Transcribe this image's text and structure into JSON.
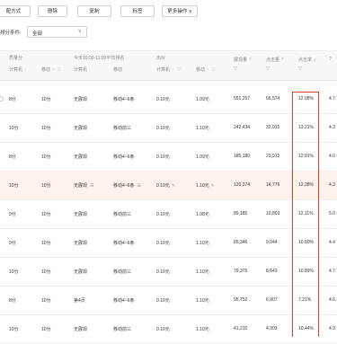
{
  "toolbar": {
    "buttons": [
      "配方式",
      "删除",
      "复制",
      "标签",
      "更多操作"
    ],
    "more_chevron": "∨"
  },
  "filter": {
    "label": "排分条件:",
    "value": "全部",
    "chevron": "∨"
  },
  "headers": {
    "group_quality": "质量分",
    "group_rank": "今天10:00-11:00平均排名",
    "group_bid": "出价",
    "pc": "计算机",
    "mobile": "移动",
    "impressions": "展现量",
    "clicks": "点击量",
    "ctr": "点击率",
    "sort": "↑",
    "sort_active": "↓",
    "filter_glyph": "▽",
    "info": "?"
  },
  "rows": [
    {
      "q_pc": "8分",
      "q_mob": "10分",
      "r_pc": "无展现",
      "r_mob": "移动4~6条",
      "bid_pc": "0.10元",
      "bid_mob": "1.09元",
      "imp": "551,257",
      "clk": "66,574",
      "ctr": "12.08%",
      "extra": "4.7"
    },
    {
      "q_pc": "10分",
      "q_mob": "10分",
      "r_pc": "无展现",
      "r_mob": "移动前三",
      "bid_pc": "0.10元",
      "bid_mob": "1.10元",
      "imp": "242,434",
      "clk": "32,015",
      "ctr": "13.21%",
      "extra": "4.3"
    },
    {
      "q_pc": "8分",
      "q_mob": "10分",
      "r_pc": "无展现",
      "r_mob": "移动4~6条",
      "bid_pc": "0.10元",
      "bid_mob": "1.09元",
      "imp": "185,180",
      "clk": "23,915",
      "ctr": "12.91%",
      "extra": "4.0"
    },
    {
      "q_pc": "10分",
      "q_mob": "10分",
      "r_pc": "无展现",
      "r_mob": "移动4~6条",
      "bid_pc": "0.10元",
      "bid_mob": "1.10元",
      "imp": "120,374",
      "clk": "14,776",
      "ctr": "12.28%",
      "extra": "4.3"
    },
    {
      "q_pc": "9分",
      "q_mob": "10分",
      "r_pc": "无展现",
      "r_mob": "移动前三",
      "bid_pc": "0.10元",
      "bid_mob": "1.08元",
      "imp": "89,185",
      "clk": "10,803",
      "ctr": "12.11%",
      "extra": "5.0"
    },
    {
      "q_pc": "9分",
      "q_mob": "10分",
      "r_pc": "无展现",
      "r_mob": "移动4~6条",
      "bid_pc": "0.10元",
      "bid_mob": "1.10元",
      "imp": "85,346",
      "clk": "9,044",
      "ctr": "10.60%",
      "extra": "4.4"
    },
    {
      "q_pc": "10分",
      "q_mob": "10分",
      "r_pc": "无展现",
      "r_mob": "移动前三",
      "bid_pc": "0.10元",
      "bid_mob": "1.10元",
      "imp": "79,375",
      "clk": "8,643",
      "ctr": "10.89%",
      "extra": "4.7"
    },
    {
      "q_pc": "8分",
      "q_mob": "10分",
      "r_pc": "第4页",
      "r_mob": "移动4~6条",
      "bid_pc": "0.10元",
      "bid_mob": "1.10元",
      "imp": "95,752",
      "clk": "6,907",
      "ctr": "7.21%",
      "extra": "4.6"
    },
    {
      "q_pc": "10分",
      "q_mob": "10分",
      "r_pc": "无展现",
      "r_mob": "移动前三",
      "bid_pc": "0.10元",
      "bid_mob": "1.10元",
      "imp": "41,210",
      "clk": "4,303",
      "ctr": "10.44%",
      "extra": "4.9"
    }
  ],
  "icons": {
    "menu": "☰",
    "edit": "✎",
    "radio": "○"
  },
  "colors": {
    "highlight_row": "#fdf3ec",
    "red_box": "#e0402e",
    "sort_active": "#4a8cf7"
  }
}
